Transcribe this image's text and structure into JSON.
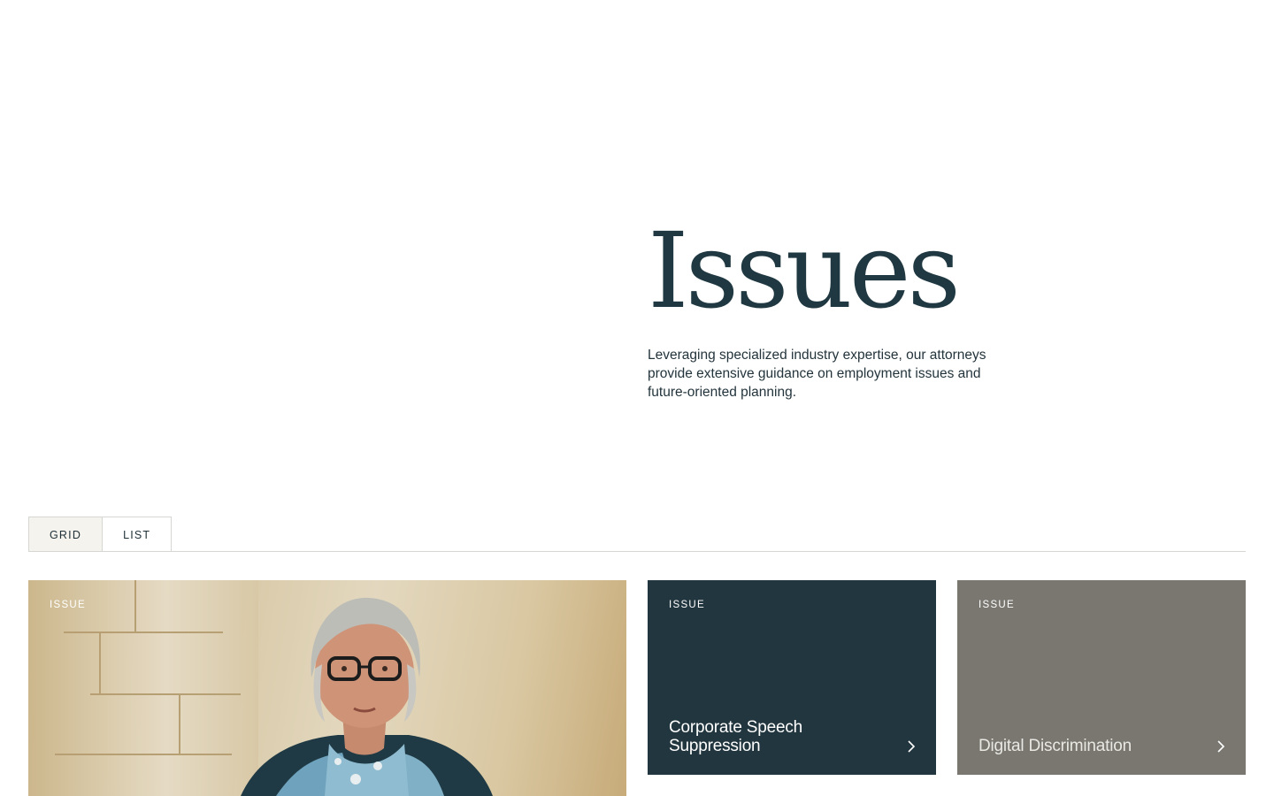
{
  "hero": {
    "title": "Issues",
    "description": "Leveraging specialized industry expertise, our attorneys provide extensive guidance on employment issues and future-oriented planning."
  },
  "view_toggle": {
    "options": [
      {
        "label": "GRID",
        "active": true
      },
      {
        "label": "LIST",
        "active": false
      }
    ]
  },
  "cards": [
    {
      "label": "ISSUE",
      "title": "",
      "style": "photo"
    },
    {
      "label": "ISSUE",
      "title": "Corporate Speech Suppression",
      "style": "dark",
      "color": "#22363f"
    },
    {
      "label": "ISSUE",
      "title": "Digital Discrimination",
      "style": "grey",
      "color": "#797770"
    }
  ],
  "colors": {
    "heading": "#1f3841",
    "card_dark": "#22363f",
    "card_grey": "#797770",
    "toggle_active_bg": "#f4f3ee"
  },
  "icons": {
    "card_arrow": "chevron-right-icon"
  }
}
